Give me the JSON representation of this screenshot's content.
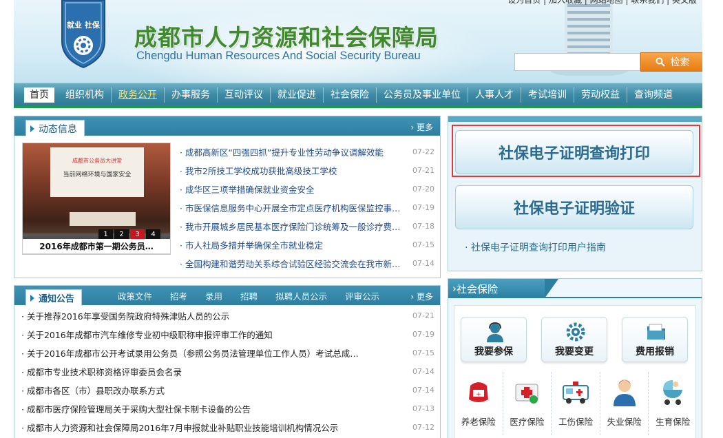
{
  "header": {
    "logo_text": "就业 社保",
    "title_cn": "成都市人力资源和社会保障局",
    "title_en": "Chengdu Human Resources And Social Security Bureau",
    "top_links": "设为首页 | 加入收藏 | 网站地图 | 联系我们 | 英文版",
    "search_button": "检索",
    "search_placeholder": ""
  },
  "nav": {
    "items": [
      "首页",
      "组织机构",
      "政务公开",
      "办事服务",
      "互动评议",
      "就业促进",
      "社会保险",
      "公务员及事业单位",
      "人事人才",
      "考试培训",
      "劳动权益",
      "查询频道"
    ]
  },
  "news": {
    "title": "动态信息",
    "more": "更多",
    "image_caption": "2016年成都市第一期公务员…",
    "image_screen_line1": "成都市公务员大讲堂",
    "image_screen_line2": "当前网络环境与国家安全",
    "slides": [
      "1",
      "2",
      "3",
      "4"
    ],
    "active_slide": 3,
    "items": [
      {
        "title": "成都高新区“四强四抓”提升专业性劳动争议调解效能",
        "date": "07-22"
      },
      {
        "title": "我市2所技工学校成功获批高级技工学校",
        "date": "07-21"
      },
      {
        "title": "成华区三项举措确保就业资金安全",
        "date": "07-20"
      },
      {
        "title": "市医保信息服务中心开展全市定点医疗机构医保监控事…",
        "date": "07-19"
      },
      {
        "title": "我市开展城乡居民基本医疗保险门诊统筹及一般诊疗费…",
        "date": "07-18"
      },
      {
        "title": "市人社局多措并举确保全市就业稳定",
        "date": "07-15"
      },
      {
        "title": "全国构建和谐劳动关系综合试验区经验交流会在我市新…",
        "date": "07-14"
      }
    ]
  },
  "notice": {
    "title": "通知公告",
    "more": "更多",
    "tabs": [
      "政策文件",
      "招考",
      "录用",
      "招聘",
      "拟聘人员公示",
      "评审公示"
    ],
    "items": [
      {
        "title": "关于推荐2016年享受国务院政府特殊津贴人员的公示",
        "date": "07-21"
      },
      {
        "title": "关于2016年成都市汽车维修专业初中级职称申报评审工作的通知",
        "date": "07-19"
      },
      {
        "title": "关于2016年成都市公开考试录用公务员（参照公务员法管理单位工作人员）考试总成…",
        "date": "07-15"
      },
      {
        "title": "成都市专业技术职称资格评审委员会名录",
        "date": "07-14"
      },
      {
        "title": "成都市各区（市）县职改办联系方式",
        "date": "07-14"
      },
      {
        "title": "成都市医疗保险管理局关于采购大型社保卡制卡设备的公告",
        "date": "07-13"
      },
      {
        "title": "成都市人力资源和社会保障局2016年7月申报就业补贴职业技能培训机构情况公示",
        "date": "07-12"
      }
    ]
  },
  "cert": {
    "query_print": "社保电子证明查询打印",
    "verify": "社保电子证明验证",
    "guide": "· 社保电子证明查询打印用户指南"
  },
  "social_insurance": {
    "title": "社会保险",
    "big_buttons": [
      {
        "label": "我要参保",
        "icon": "customer-service-icon"
      },
      {
        "label": "我要变更",
        "icon": "gear-icon"
      },
      {
        "label": "费用报销",
        "icon": "folder-icon"
      }
    ],
    "small_items": [
      {
        "label": "养老保险",
        "icon": "piggy-bank-icon"
      },
      {
        "label": "医疗保险",
        "icon": "first-aid-kit-icon"
      },
      {
        "label": "工伤保险",
        "icon": "ambulance-icon"
      },
      {
        "label": "失业保险",
        "icon": "person-icon"
      },
      {
        "label": "生育保险",
        "icon": "baby-stroller-icon"
      }
    ]
  },
  "colors": {
    "nav_bg": "#3d8aa5",
    "title_green": "#3f8a2c",
    "search_orange": "#e67c12",
    "highlight_red": "#e03a3a"
  }
}
